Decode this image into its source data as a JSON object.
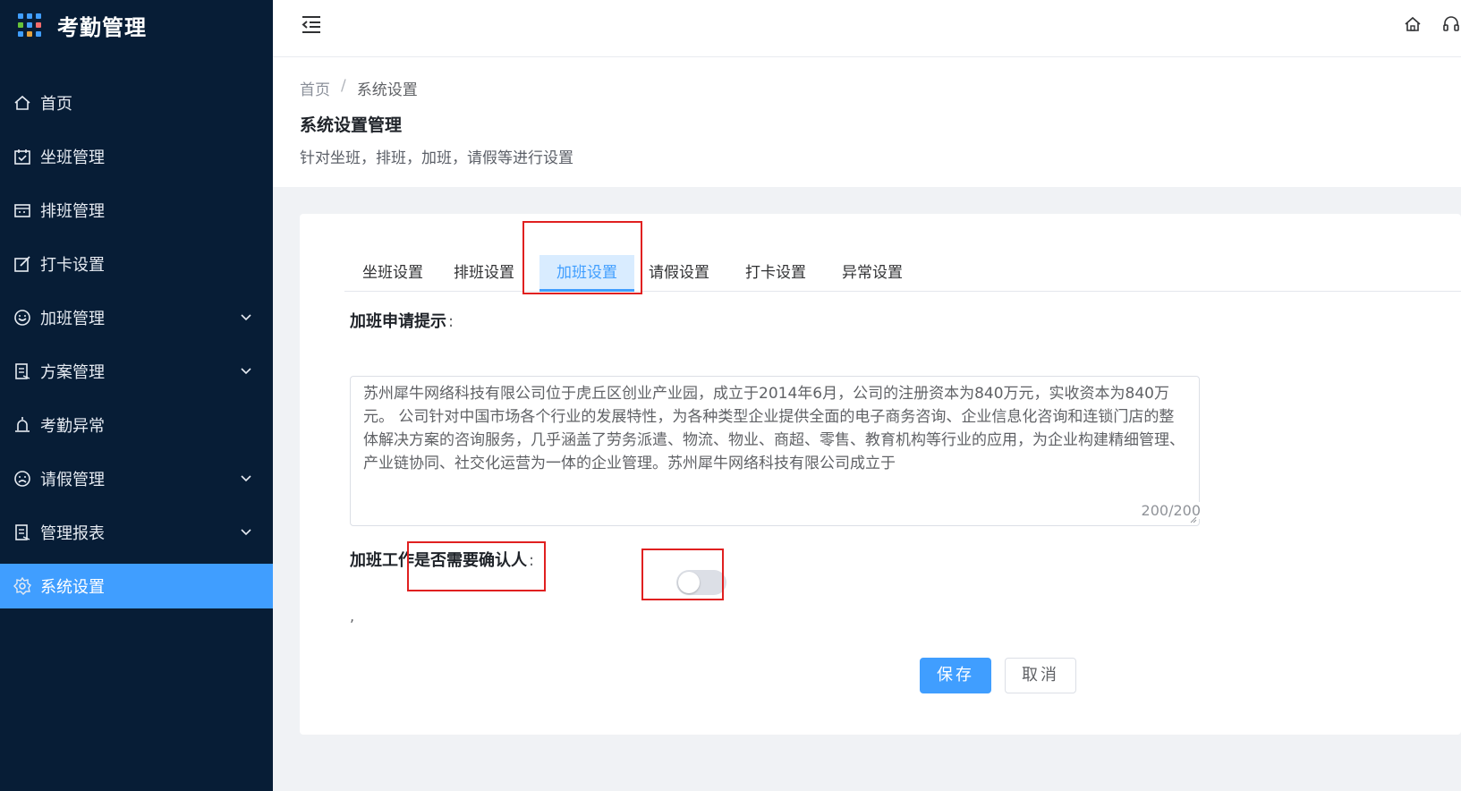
{
  "app": {
    "title": "考勤管理",
    "logo_dot_colors": [
      "#409eff",
      "#409eff",
      "#409eff",
      "#67c23a",
      "#409eff",
      "#f56c6c",
      "#409eff",
      "#e6a23c",
      "#409eff"
    ]
  },
  "sidebar": {
    "items": [
      {
        "label": "首页",
        "icon": "home-icon",
        "has_arrow": false,
        "active": false
      },
      {
        "label": "坐班管理",
        "icon": "calendar-check-icon",
        "has_arrow": false,
        "active": false
      },
      {
        "label": "排班管理",
        "icon": "calendar-icon",
        "has_arrow": false,
        "active": false
      },
      {
        "label": "打卡设置",
        "icon": "edit-icon",
        "has_arrow": false,
        "active": false
      },
      {
        "label": "加班管理",
        "icon": "smile-icon",
        "has_arrow": true,
        "active": false
      },
      {
        "label": "方案管理",
        "icon": "document-icon",
        "has_arrow": true,
        "active": false
      },
      {
        "label": "考勤异常",
        "icon": "alarm-icon",
        "has_arrow": false,
        "active": false
      },
      {
        "label": "请假管理",
        "icon": "sad-face-icon",
        "has_arrow": true,
        "active": false
      },
      {
        "label": "管理报表",
        "icon": "report-icon",
        "has_arrow": true,
        "active": false
      },
      {
        "label": "系统设置",
        "icon": "gear-icon",
        "has_arrow": false,
        "active": true
      }
    ]
  },
  "header": {
    "icons": [
      "menu-fold-icon",
      "home-icon",
      "headset-icon"
    ]
  },
  "breadcrumb": {
    "home": "首页",
    "separator": "/",
    "current": "系统设置"
  },
  "page": {
    "title": "系统设置管理",
    "description": "针对坐班，排班，加班，请假等进行设置"
  },
  "tabs": [
    {
      "label": "坐班设置",
      "active": false
    },
    {
      "label": "排班设置",
      "active": false
    },
    {
      "label": "加班设置",
      "active": true
    },
    {
      "label": "请假设置",
      "active": false
    },
    {
      "label": "打卡设置",
      "active": false
    },
    {
      "label": "异常设置",
      "active": false
    }
  ],
  "form": {
    "tip_label": "加班申请提示",
    "colon": ":",
    "tip_text": "苏州犀牛网络科技有限公司位于虎丘区创业产业园，成立于2014年6月，公司的注册资本为840万元，实收资本为840万元。 公司针对中国市场各个行业的发展特性，为各种类型企业提供全面的电子商务咨询、企业信息化咨询和连锁门店的整体解决方案的咨询服务，几乎涵盖了劳务派遣、物流、物业、商超、零售、教育机构等行业的应用，为企业构建精细管理、产业链协同、社交化运营为一体的企业管理。苏州犀牛网络科技有限公司成立于",
    "char_count": "200/200",
    "confirm_label": "加班工作是否需要确认人",
    "confirm_enabled": false,
    "stray_mark": ","
  },
  "buttons": {
    "save": "保存",
    "cancel": "取消"
  },
  "colors": {
    "sidebar_bg": "#071d36",
    "accent": "#409eff",
    "annotation": "#e02020"
  }
}
